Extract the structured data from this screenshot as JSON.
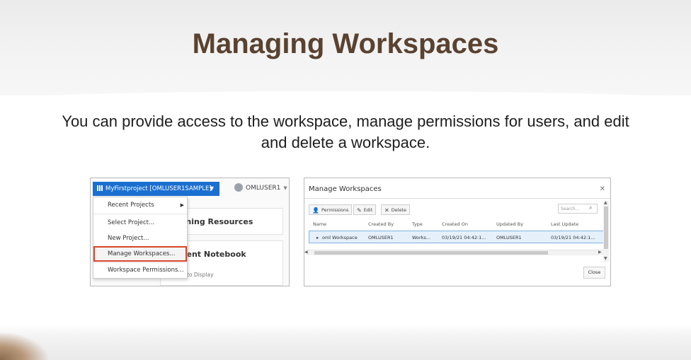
{
  "slide": {
    "title": "Managing Workspaces",
    "subtitle": "You can provide access to the workspace, manage permissions for users, and edit and delete a workspace."
  },
  "left_panel": {
    "project_button": "MyFirstproject [OMLUSER1SAMPLE]",
    "username": "OMLUSER1",
    "menu_items": [
      "Recent Projects",
      "Select Project...",
      "New Project...",
      "Manage Workspaces...",
      "Workspace Permissions..."
    ],
    "card_titles": [
      "rning Resources",
      "cent Notebook"
    ],
    "card_sub": "to Display"
  },
  "right_panel": {
    "dialog_title": "Manage Workspaces",
    "toolbar": {
      "permissions": "Permissions",
      "edit": "Edit",
      "delete": "Delete"
    },
    "search_placeholder": "Search...",
    "columns": [
      "Name",
      "Created By",
      "Type",
      "Created On",
      "Updated By",
      "Last Update"
    ],
    "rows": [
      [
        "oml Workspace",
        "OMLUSER1",
        "Works...",
        "03/19/21 04:42:1...",
        "OMLUSER1",
        "03/19/21 04:42:1..."
      ]
    ],
    "close_label": "Close"
  },
  "colors": {
    "title": "#5a4230",
    "accent_blue": "#1a6fd1",
    "highlight_red": "#d8452b"
  },
  "icons": [
    "grid-icon",
    "caret-down-icon",
    "avatar-icon",
    "chevron-right-icon",
    "close-icon",
    "person-icon",
    "pencil-icon",
    "x-icon",
    "search-icon",
    "expand-triangle-icon"
  ]
}
